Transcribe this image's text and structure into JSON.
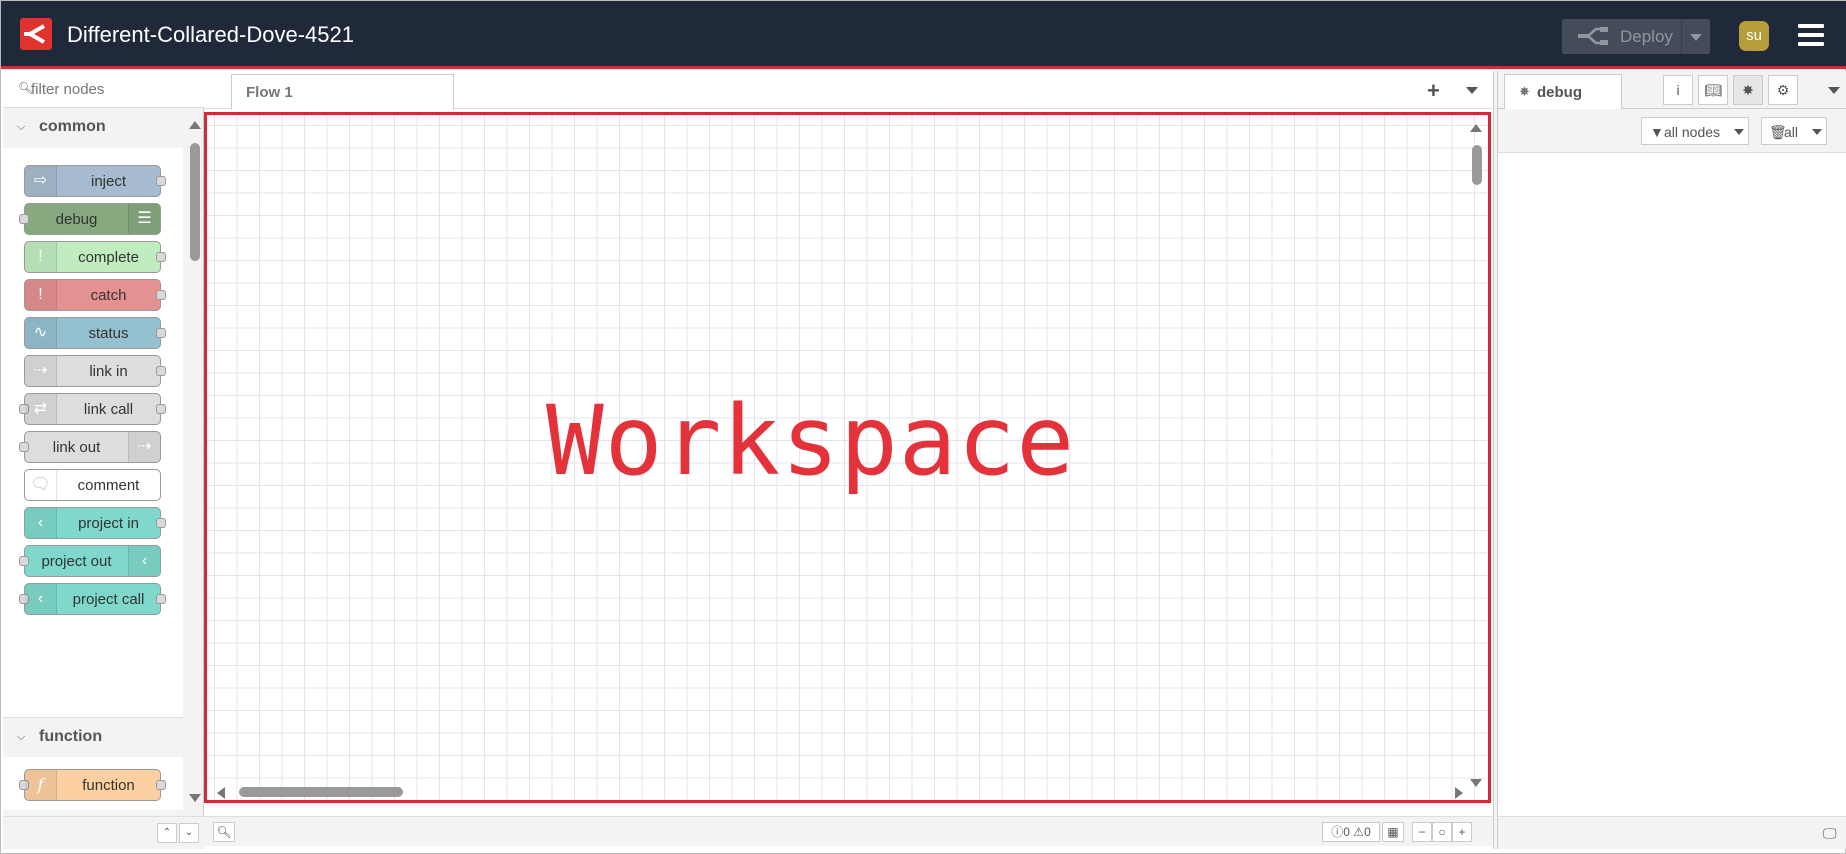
{
  "header": {
    "title": "Different-Collared-Dove-4521",
    "logo_icon": "flowfuse-logo-icon",
    "deploy_label": "Deploy",
    "user_initials": "su",
    "accent_color": "#c9312f",
    "background_color": "#20293a"
  },
  "palette": {
    "filter_placeholder": "filter nodes",
    "categories": [
      {
        "label": "common",
        "nodes": [
          {
            "label": "inject",
            "color": "#a6bbcf",
            "icon": "arrow-in-icon"
          },
          {
            "label": "debug",
            "color": "#87a980",
            "icon": "list-icon"
          },
          {
            "label": "complete",
            "color": "#c0edc0",
            "icon": "exclamation-icon"
          },
          {
            "label": "catch",
            "color": "#e49191",
            "icon": "exclamation-icon"
          },
          {
            "label": "status",
            "color": "#94c1d0",
            "icon": "pulse-icon"
          },
          {
            "label": "link in",
            "color": "#dddddd",
            "icon": "link-in-icon"
          },
          {
            "label": "link call",
            "color": "#dddddd",
            "icon": "link-call-icon"
          },
          {
            "label": "link out",
            "color": "#dddddd",
            "icon": "link-out-icon"
          },
          {
            "label": "comment",
            "color": "#ffffff",
            "icon": "comment-icon"
          },
          {
            "label": "project in",
            "color": "#7fd8cb",
            "icon": "project-icon"
          },
          {
            "label": "project out",
            "color": "#7fd8cb",
            "icon": "project-icon"
          },
          {
            "label": "project call",
            "color": "#7fd8cb",
            "icon": "project-icon"
          }
        ]
      },
      {
        "label": "function",
        "nodes": [
          {
            "label": "function",
            "color": "#fdd0a2",
            "icon": "function-icon"
          }
        ]
      }
    ]
  },
  "workspace": {
    "tabs": [
      {
        "label": "Flow 1"
      }
    ],
    "overlay_text": "Workspace",
    "overlay_color": "#e3323a",
    "border_color": "#d42a36",
    "footer": {
      "errors": "0",
      "warnings": "0"
    }
  },
  "sidebar": {
    "active_tab": "debug",
    "filter_label": "all nodes",
    "clear_label": "all"
  }
}
